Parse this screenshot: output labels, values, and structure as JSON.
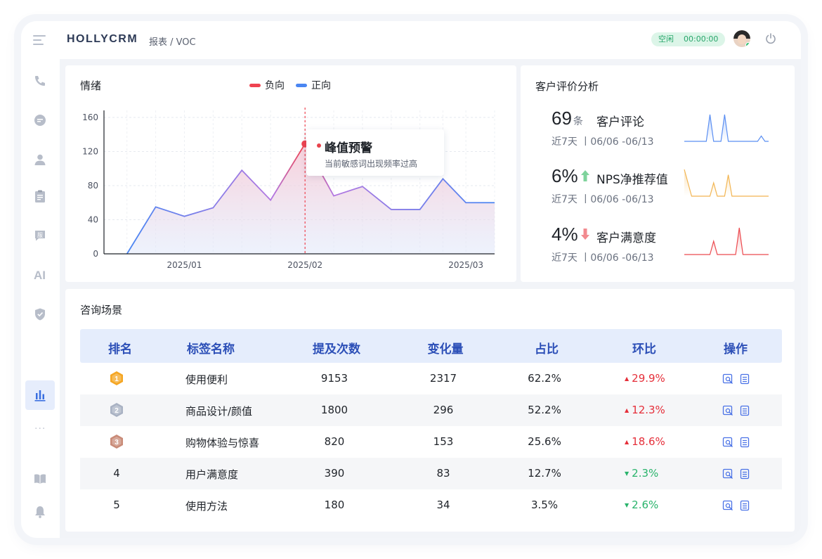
{
  "header": {
    "brand": "HOLLYCRM",
    "breadcrumb": "报表 / VOC",
    "status_label": "空闲",
    "status_time": "00:00:00"
  },
  "sidebar": {
    "items": [
      "phone-icon",
      "chat-icon",
      "user-icon",
      "clipboard-icon",
      "service-icon",
      "AI",
      "shield-icon",
      "chart-icon",
      "more-icon",
      "book-icon",
      "bell-icon"
    ],
    "ai_label": "AI",
    "more_label": "···",
    "active": "chart-icon"
  },
  "emotion": {
    "title": "情绪",
    "legend": [
      {
        "label": "负向",
        "color": "#ef4350"
      },
      {
        "label": "正向",
        "color": "#4a86f2"
      }
    ],
    "tooltip_title": "峰值预警",
    "tooltip_text": "当前敏感词出现频率过高"
  },
  "chart_data": {
    "type": "area",
    "x": [
      "2025-01-05",
      "2025-01-10",
      "2025-01-15",
      "2025-01-20",
      "2025-01-25",
      "2025-01-30",
      "2025-02-05",
      "2025-02-10",
      "2025-02-15",
      "2025-02-20",
      "2025-02-25",
      "2025-03-01",
      "2025-03-05",
      "2025-03-10"
    ],
    "xticks": [
      "2025/01",
      "2025/02",
      "2025/03"
    ],
    "xtick_positions": [
      "2025-01-15",
      "2025-02-05",
      "2025-03-05"
    ],
    "series": [
      {
        "name": "正向",
        "color": "#4a86f2",
        "values": [
          0,
          55,
          44,
          54,
          98,
          63,
          129,
          68,
          79,
          52,
          52,
          88,
          60,
          60
        ]
      }
    ],
    "peak": {
      "x": "2025-02-05",
      "y": 129,
      "color": "#ef4350"
    },
    "yticks": [
      0,
      40,
      80,
      120,
      160
    ],
    "ylim": [
      0,
      160
    ],
    "grid": true
  },
  "evaluation": {
    "title": "客户评价分析",
    "rows": [
      {
        "value": "69",
        "unit": "条",
        "label": "客户评论",
        "range": "近7天 丨06/06 -06/13",
        "trend": "",
        "color": "#5b8ff2",
        "spark": [
          0,
          0,
          0,
          0,
          0,
          0,
          0,
          1,
          0,
          0,
          0,
          1,
          0,
          0,
          0,
          0,
          0,
          0,
          0,
          0,
          0,
          0.2,
          0,
          0
        ]
      },
      {
        "value": "6%",
        "unit": "",
        "label": "NPS净推荐值",
        "range": "近7天 丨06/06 -06/13",
        "trend": "up",
        "color": "#f2b552",
        "spark": [
          1,
          0.5,
          0,
          0,
          0,
          0,
          0,
          0,
          0.5,
          0,
          0,
          0,
          0.8,
          0,
          0,
          0,
          0,
          0,
          0,
          0,
          0,
          0,
          0,
          0
        ]
      },
      {
        "value": "4%",
        "unit": "",
        "label": "客户满意度",
        "range": "近7天 丨06/06 -06/13",
        "trend": "down",
        "color": "#ec4a4f",
        "spark": [
          0,
          0,
          0,
          0,
          0,
          0,
          0,
          0,
          0.5,
          0,
          0,
          0,
          0,
          0,
          0,
          1,
          0,
          0,
          0,
          0,
          0,
          0,
          0,
          0
        ]
      }
    ]
  },
  "scenes": {
    "title": "咨询场景",
    "columns": [
      "排名",
      "标签名称",
      "提及次数",
      "变化量",
      "占比",
      "环比",
      "操作"
    ],
    "rows": [
      {
        "rank": "1",
        "label": "使用便利",
        "mentions": "9153",
        "change": "2317",
        "ratio": "62.2%",
        "mom": "29.9%",
        "dir": "up"
      },
      {
        "rank": "2",
        "label": "商品设计/颜值",
        "mentions": "1800",
        "change": "296",
        "ratio": "52.2%",
        "mom": "12.3%",
        "dir": "up"
      },
      {
        "rank": "3",
        "label": "购物体验与惊喜",
        "mentions": "820",
        "change": "153",
        "ratio": "25.6%",
        "mom": "18.6%",
        "dir": "up"
      },
      {
        "rank": "4",
        "label": "用户满意度",
        "mentions": "390",
        "change": "83",
        "ratio": "12.7%",
        "mom": "2.3%",
        "dir": "down"
      },
      {
        "rank": "5",
        "label": "使用方法",
        "mentions": "180",
        "change": "34",
        "ratio": "3.5%",
        "mom": "2.6%",
        "dir": "down"
      }
    ]
  },
  "colors": {
    "accent": "#2c4fb7",
    "up": "#e52f3a",
    "down": "#29b36b",
    "gold": "#f5a623",
    "silver": "#a9b2c3",
    "bronze": "#c98b78"
  }
}
